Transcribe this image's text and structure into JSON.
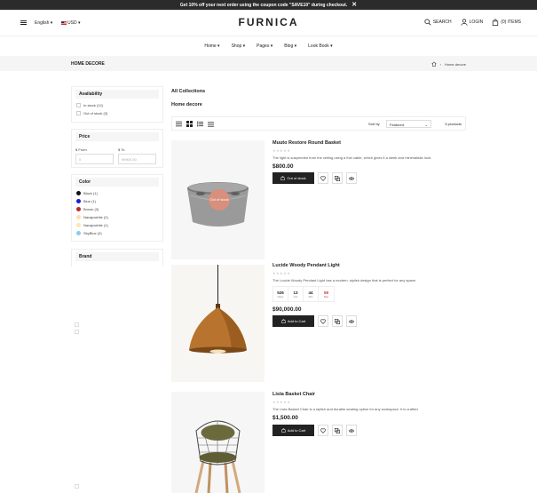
{
  "announcement": {
    "text": "Get 10% off your next order using the coupon code \"SAVE10\" during checkout.",
    "close": "✕"
  },
  "header": {
    "language": "English ▾",
    "currency": "USD ▾",
    "logo": "FURNICA",
    "search_label": "SEARCH",
    "login_label": "LOGIN",
    "cart_label": "(0) ITEMS"
  },
  "nav": [
    "Home ▾",
    "Shop ▾",
    "Pages ▾",
    "Blog ▾",
    "Look Book ▾"
  ],
  "breadcrumb": {
    "title": "HOME DECORE",
    "sep": "›",
    "current": "Home decore"
  },
  "filters": {
    "availability": {
      "title": "Availability",
      "options": [
        "In stock (12)",
        "Out of stock (3)"
      ]
    },
    "price": {
      "title": "Price",
      "from_label": "$ From",
      "to_label": "$ To",
      "from_placeholder": "0",
      "to_placeholder": "99900.00"
    },
    "color": {
      "title": "Color",
      "options": [
        {
          "label": "Black (1)",
          "color": "#111111"
        },
        {
          "label": "Blue (1)",
          "color": "#1a1adb"
        },
        {
          "label": "Brown (3)",
          "color": "#b22b2b"
        },
        {
          "label": "Navajowhite (2)",
          "color": "#ffdead"
        },
        {
          "label": "Navajowhite (1)",
          "color": "#ffe4b5"
        },
        {
          "label": "SkyBlue (3)",
          "color": "#87ceeb"
        }
      ]
    },
    "brand": {
      "title": "Brand"
    }
  },
  "collections": {
    "all": "All Collections",
    "current": "Home decore"
  },
  "toolbar": {
    "sort_label": "Sort by",
    "sort_value": "Featured",
    "count": "5 products"
  },
  "products": [
    {
      "name": "Muuto Restore Round Basket",
      "stars": "★★★★★",
      "desc": "The light is suspended from the ceiling using a thin cable, which gives it a sleek and minimalistic look.",
      "price": "$800.00",
      "button": "Out of stock",
      "badge": "Out of stock"
    },
    {
      "name": "Lucide Woody Pendant Light",
      "stars": "★★★★★",
      "desc": "The Lucide Woody Pendant Light has a modern, stylish design that is perfect for any space.",
      "price": "$90,000.00",
      "button": "Add to Cart",
      "countdown": [
        {
          "value": "526",
          "unit": "Days"
        },
        {
          "value": "13",
          "unit": "Hrs"
        },
        {
          "value": "44",
          "unit": "Min"
        },
        {
          "value": "59",
          "unit": "Sec"
        }
      ]
    },
    {
      "name": "Lista Basket Chair",
      "stars": "★★★★★",
      "desc": "The Lista Basket Chair is a stylish and durable seating option for any workspace. It is crafted",
      "price": "$1,500.00",
      "button": "Add to Cart"
    }
  ]
}
